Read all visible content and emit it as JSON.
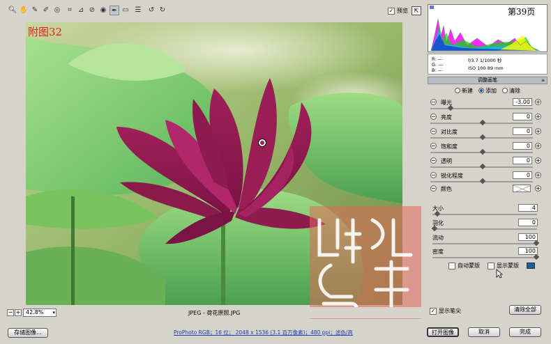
{
  "page_number": "第39页",
  "figure_label": "附图32",
  "toolbar": {
    "tools": [
      "zoom-tool",
      "hand-tool",
      "white-balance-tool",
      "color-sampler-tool",
      "target-adjustment-tool",
      "crop-tool",
      "straighten-tool",
      "spot-removal-tool",
      "red-eye-tool",
      "adjustment-brush-tool",
      "graduated-filter-tool",
      "preferences-tool",
      "rotate-ccw-tool",
      "rotate-cw-tool"
    ],
    "active_tool": "adjustment-brush-tool",
    "preview_label": "预览",
    "preview_checked": true
  },
  "status": {
    "zoom": "42.8%",
    "filename": "JPEG - 荷花原照.JPG"
  },
  "histogram": {
    "colors": [
      "#ff00ff",
      "#00e000",
      "#00c0ff",
      "#ffff00",
      "#1a2bd0"
    ]
  },
  "readout": {
    "r": "R:  ---",
    "g": "G:  ---",
    "b": "B:  ---",
    "exposure": "f/3.7   1/1000 秒",
    "iso": "ISO 100   89 mm"
  },
  "panel": {
    "title": "调整画笔",
    "modes": [
      "新建",
      "添加",
      "清除"
    ],
    "selected_mode": "添加",
    "adjustments": [
      {
        "label": "曝光",
        "value": "-3.00",
        "position": 0.18
      },
      {
        "label": "亮度",
        "value": "0",
        "position": 0.5
      },
      {
        "label": "对比度",
        "value": "0",
        "position": 0.5
      },
      {
        "label": "饱和度",
        "value": "0",
        "position": 0.5
      },
      {
        "label": "透明",
        "value": "0",
        "position": 0.5
      },
      {
        "label": "锐化程度",
        "value": "0",
        "position": 0.5
      }
    ],
    "color_label": "颜色",
    "brush": [
      {
        "label": "大小",
        "value": "4",
        "position": 0.03
      },
      {
        "label": "羽化",
        "value": "0",
        "position": 0.0
      },
      {
        "label": "流动",
        "value": "100",
        "position": 1.0
      },
      {
        "label": "密度",
        "value": "100",
        "position": 1.0
      }
    ],
    "auto_mask_label": "自动蒙版",
    "show_mask_label": "显示蒙版",
    "show_pins_label": "显示笔尖",
    "show_pins_checked": true,
    "clear_all_label": "清除全部"
  },
  "bottom": {
    "save_label": "存储图像...",
    "workflow": "ProPhoto RGB；16 位； 2048 x 1536 (3.1 百万像素)；480 ppi；滤色/高",
    "open_label": "打开图像",
    "cancel_label": "取消",
    "done_label": "完成"
  }
}
